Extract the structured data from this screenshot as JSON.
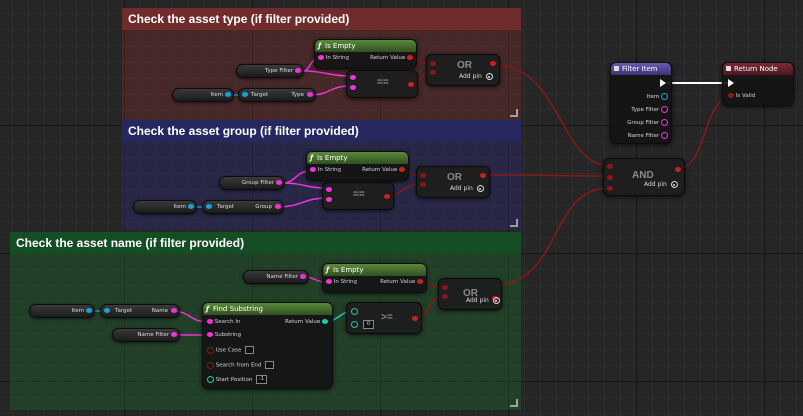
{
  "colors": {
    "comment_type": "#6b2c2c",
    "comment_group": "#2b2b6b",
    "comment_name": "#1e5a2c",
    "wire_exec": "#ffffff",
    "wire_bool": "#8a1818",
    "wire_string": "#f233d8",
    "wire_object": "#16a3d8",
    "wire_int": "#24c7a7"
  },
  "comments": {
    "asset_type": "Check the asset type (if filter provided)",
    "asset_group": "Check the asset group (if filter provided)",
    "asset_name": "Check the asset name (if filter provided)"
  },
  "type_section": {
    "var_type_filter": "Type Filter",
    "var_item": "Item",
    "get_target": "Target",
    "get_type": "Type",
    "is_empty_title": "Is Empty",
    "in_string": "In String",
    "return_value": "Return Value",
    "equals": "==",
    "or_label": "OR",
    "add_pin": "Add pin"
  },
  "group_section": {
    "var_group_filter": "Group Filter",
    "var_item": "Item",
    "get_target": "Target",
    "get_group": "Group",
    "is_empty_title": "Is Empty",
    "in_string": "In String",
    "return_value": "Return Value",
    "equals": "==",
    "or_label": "OR",
    "add_pin": "Add pin"
  },
  "name_section": {
    "var_name_filter_top": "Name Filter",
    "var_item": "Item",
    "get_target": "Target",
    "get_name": "Name",
    "var_name_filter_bottom": "Name Filter",
    "is_empty_title": "Is Empty",
    "in_string": "In String",
    "return_value": "Return Value",
    "find_substring_title": "Find Substring",
    "search_in": "Search In",
    "substring": "Substring",
    "use_case": "Use Case",
    "search_from_end": "Search from End",
    "start_position": "Start Position",
    "start_position_value": "-1",
    "find_return_value": "Return Value",
    "gte": ">=",
    "gte_b_value": "0",
    "or_label": "OR",
    "add_pin": "Add pin"
  },
  "and_node": {
    "label": "AND",
    "add_pin": "Add pin"
  },
  "filter_item": {
    "title": "Filter Item",
    "item": "Item",
    "type_filter": "Type Filter",
    "group_filter": "Group Filter",
    "name_filter": "Name Filter"
  },
  "return_node": {
    "title": "Return Node",
    "is_valid": "Is Valid"
  }
}
